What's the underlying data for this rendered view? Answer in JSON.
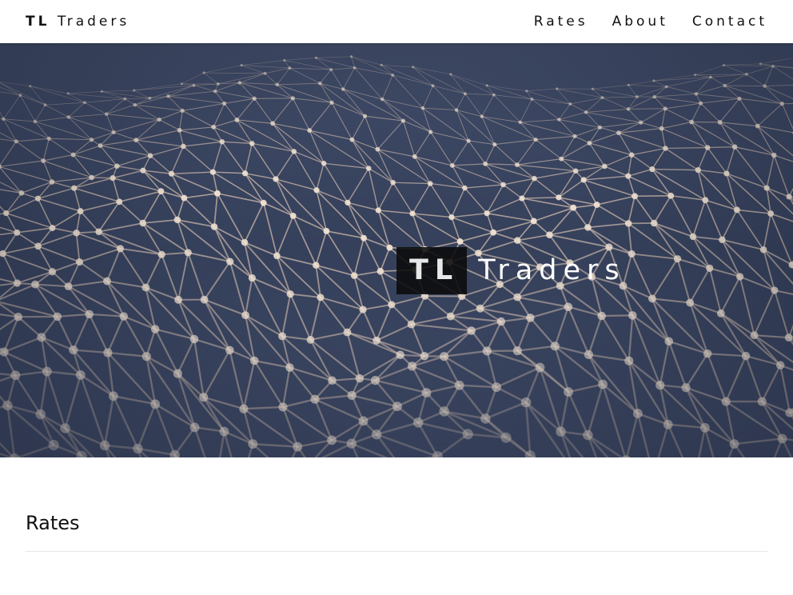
{
  "navbar": {
    "brand_bold": "TL",
    "brand_rest": "Traders",
    "links": [
      "Rates",
      "About",
      "Contact"
    ]
  },
  "hero": {
    "title_bold": "TL",
    "title_rest": "Traders"
  },
  "rates_section": {
    "title": "Rates"
  },
  "colors": {
    "hero_background": "#3a4560",
    "mesh_line": "#c9b6a8",
    "mesh_node": "#f2e4d4",
    "title_box": "#0a0a0a"
  }
}
